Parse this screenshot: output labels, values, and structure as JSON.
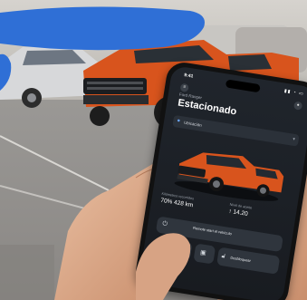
{
  "app": {
    "status_time": "9:41",
    "status_icons": "▮▮ ◔ ▭",
    "subtitle": "Ford Ranger",
    "title": "Estacionado",
    "location_label": "Ubicación",
    "stats": [
      {
        "label": "Kilómetros recorridos",
        "value": "70% 428 km"
      },
      {
        "label": "Nivel de aceite",
        "value": "↑ 14.20"
      }
    ],
    "actions": {
      "remote_start": {
        "label": "Remote start el vehículo",
        "icon": "power-icon"
      },
      "lock": {
        "label": "Bloquear",
        "icon": "lock-icon"
      },
      "unlock": {
        "label": "Desbloquear",
        "icon": "unlock-icon"
      },
      "center": {
        "label": "",
        "icon": "car-icon"
      }
    },
    "colors": {
      "truck": "#d8541d",
      "screen": "#1c2026",
      "accent": "#6aa6ff",
      "banner": "#2f6fd6"
    }
  }
}
